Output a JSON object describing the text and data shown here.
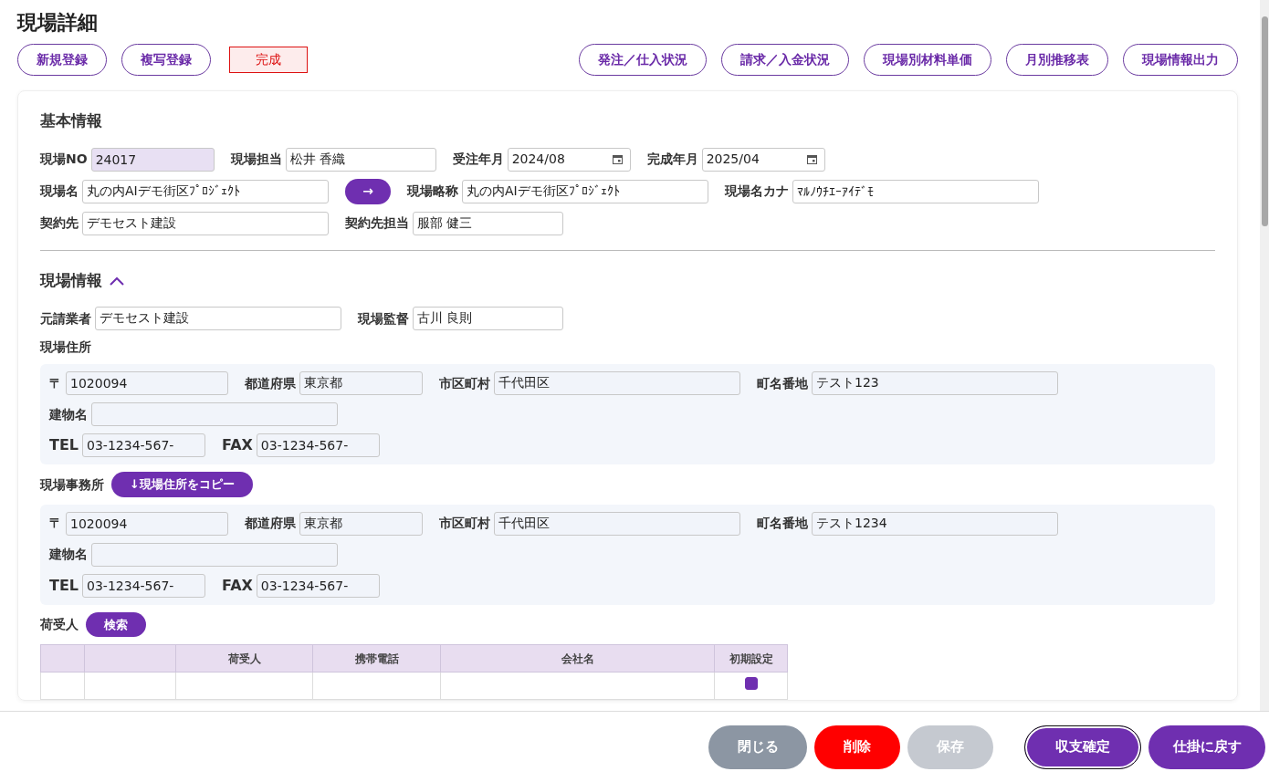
{
  "page_title": "現場詳細",
  "left_actions": [
    "新規登録",
    "複写登録"
  ],
  "status_badge": "完成",
  "right_actions": [
    "発注／仕入状況",
    "請求／入金状況",
    "現場別材料単価",
    "月別推移表",
    "現場情報出力"
  ],
  "basic_info": {
    "title": "基本情報",
    "rows": [
      [
        {
          "label": "現場NO",
          "value": "24017",
          "kind": "readonly"
        },
        {
          "label": "現場担当",
          "value": "松井 香織",
          "kind": "text"
        },
        {
          "label": "受注年月",
          "value": "2024/08",
          "kind": "date"
        },
        {
          "label": "完成年月",
          "value": "2025/04",
          "kind": "date"
        }
      ],
      [
        {
          "label": "現場名",
          "value": "丸の内AIデモ街区ﾌﾟﾛｼﾞｪｸﾄ",
          "kind": "text"
        },
        {
          "label": "→",
          "kind": "button"
        },
        {
          "label": "現場略称",
          "value": "丸の内AIデモ街区ﾌﾟﾛｼﾞｪｸﾄ",
          "kind": "text"
        },
        {
          "label": "現場名カナ",
          "value": "ﾏﾙﾉｳﾁｴｰｱｲﾃﾞﾓ",
          "kind": "text"
        }
      ],
      [
        {
          "label": "契約先",
          "value": "デモセスト建設",
          "kind": "text"
        },
        {
          "label": "契約先担当",
          "value": "服部 健三",
          "kind": "text"
        }
      ]
    ]
  },
  "site_info": {
    "title": "現場情報",
    "expanded": true,
    "rows": [
      [
        {
          "label": "元請業者",
          "value": "デモセスト建設",
          "kind": "text"
        },
        {
          "label": "現場監督",
          "value": "古川 良則",
          "kind": "text"
        }
      ]
    ],
    "addresses": [
      {
        "title": "現場住所",
        "postal": {
          "label": "〒",
          "value": "1020094"
        },
        "prefecture": {
          "label": "都道府県",
          "value": "東京都"
        },
        "city": {
          "label": "市区町村",
          "value": "千代田区"
        },
        "street": {
          "label": "町名番地",
          "value": "テスト123"
        },
        "building": {
          "label": "建物名"
        },
        "tel": {
          "label": "TEL",
          "value": "03-1234-567-"
        },
        "fax": {
          "label": "FAX",
          "value": "03-1234-567-"
        }
      },
      {
        "title": "現場事務所",
        "copy_button": "↓現場住所をコピー",
        "postal": {
          "label": "〒",
          "value": "1020094"
        },
        "prefecture": {
          "label": "都道府県",
          "value": "東京都"
        },
        "city": {
          "label": "市区町村",
          "value": "千代田区"
        },
        "street": {
          "label": "町名番地",
          "value": "テスト1234"
        },
        "building": {
          "label": "建物名"
        },
        "tel": {
          "label": "TEL",
          "value": "03-1234-567-"
        },
        "fax": {
          "label": "FAX",
          "value": "03-1234-567-"
        }
      }
    ],
    "consignee": {
      "title": "荷受人",
      "search_button": "検索",
      "table": {
        "columns": [
          "荷受人",
          "携帯電話",
          "会社名",
          "初期設定"
        ],
        "rows": [
          {
            "default": true
          }
        ]
      }
    }
  },
  "footer_buttons": [
    {
      "label": "閉じる",
      "kind": "secondary",
      "disabled": false,
      "focused": false
    },
    {
      "label": "削除",
      "kind": "danger",
      "disabled": false,
      "focused": false
    },
    {
      "label": "保存",
      "kind": "save",
      "disabled": true,
      "focused": false
    },
    {
      "label": "収支確定",
      "kind": "primary",
      "disabled": false,
      "focused": true
    },
    {
      "label": "仕掛に戻す",
      "kind": "primary",
      "disabled": false,
      "focused": false
    }
  ]
}
